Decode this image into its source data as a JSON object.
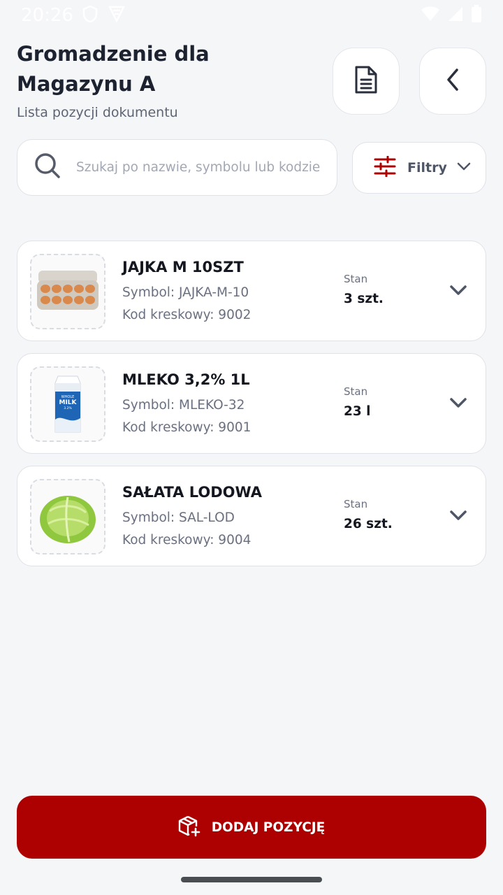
{
  "status_bar": {
    "time": "20:26"
  },
  "header": {
    "title_line1": "Gromadzenie dla",
    "title_line2": "Magazynu A",
    "subtitle": "Lista pozycji dokumentu"
  },
  "search": {
    "placeholder": "Szukaj po nazwie, symbolu lub kodzie",
    "value": ""
  },
  "filter": {
    "label": "Filtry"
  },
  "items": [
    {
      "name": "JAJKA M 10SZT",
      "symbol": "Symbol: JAJKA-M-10",
      "barcode": "Kod kreskowy: 9002",
      "stock_label": "Stan",
      "stock_value": "3 szt.",
      "image": "eggs-carton"
    },
    {
      "name": "MLEKO 3,2% 1L",
      "symbol": "Symbol: MLEKO-32",
      "barcode": "Kod kreskowy: 9001",
      "stock_label": "Stan",
      "stock_value": "23 l",
      "image": "milk-carton"
    },
    {
      "name": "SAŁATA LODOWA",
      "symbol": "Symbol: SAL-LOD",
      "barcode": "Kod kreskowy: 9004",
      "stock_label": "Stan",
      "stock_value": "26 szt.",
      "image": "iceberg-lettuce"
    }
  ],
  "milk_pack": {
    "brand_line1": "WHOLE",
    "brand_line2": "MILK",
    "fat": "3.2%"
  },
  "actions": {
    "add_label": "DODAJ POZYCJĘ"
  },
  "colors": {
    "accent": "#ad0000",
    "background": "#f5f6f8",
    "card": "#ffffff",
    "muted_text": "#6a7080"
  }
}
